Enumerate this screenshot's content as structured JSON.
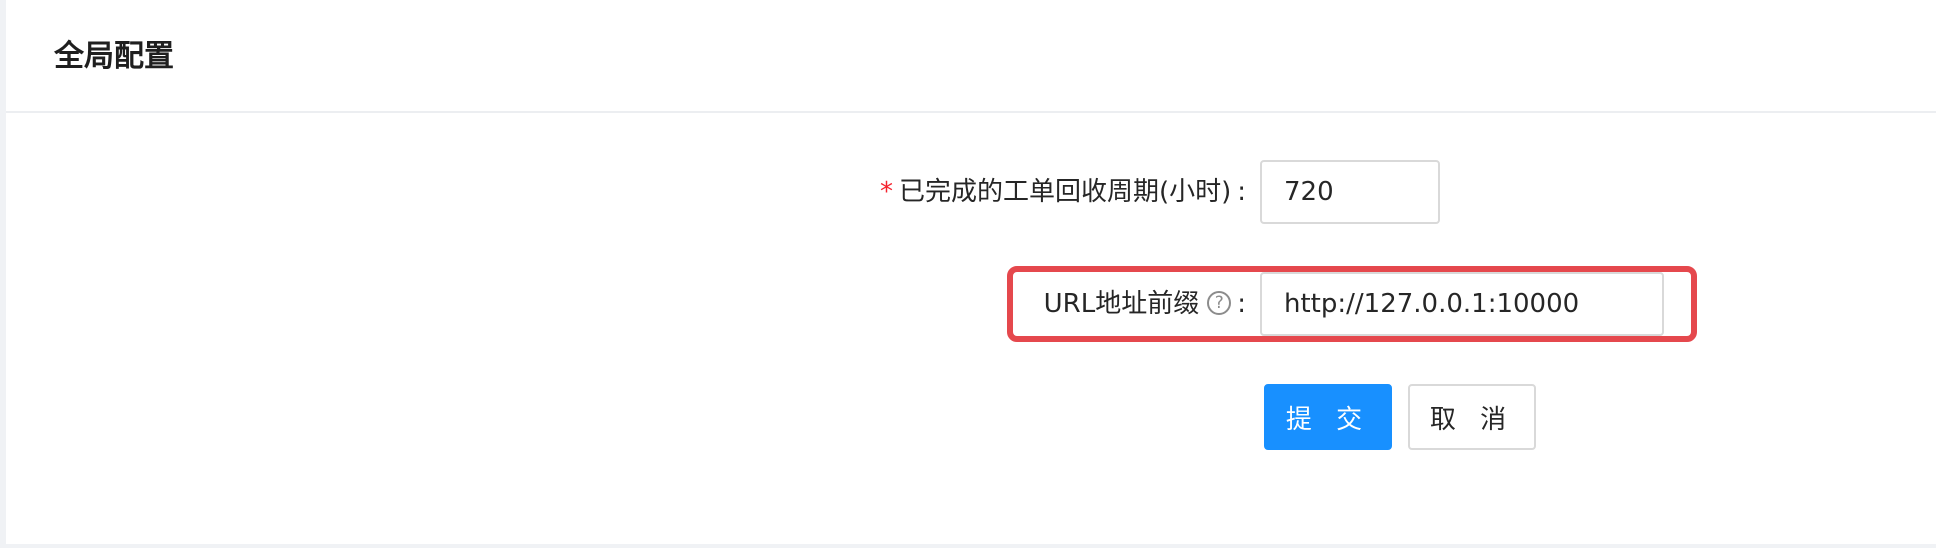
{
  "card": {
    "title": "全局配置"
  },
  "form": {
    "recycle_period": {
      "required_mark": "*",
      "label": "已完成的工单回收周期(小时)",
      "colon": ":",
      "value": "720"
    },
    "url_prefix": {
      "label": "URL地址前缀",
      "help_icon": "question-circle-icon",
      "help_glyph": "?",
      "colon": ":",
      "value": "http://127.0.0.1:10000"
    }
  },
  "actions": {
    "submit_label": "提 交",
    "cancel_label": "取 消"
  },
  "colors": {
    "primary": "#1890ff",
    "required": "#f5222d",
    "highlight": "#e5484d"
  }
}
